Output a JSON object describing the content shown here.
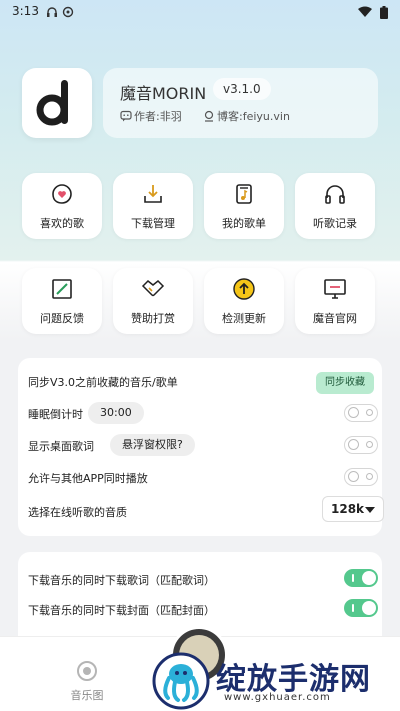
{
  "status_bar": {
    "time": "3:13"
  },
  "app": {
    "name": "魔音MORIN",
    "version": "v3.1.0",
    "author": "作者:非羽",
    "blog": "博客:feiyu.vin"
  },
  "tiles": [
    {
      "label": "喜欢的歌",
      "icon": "heart-icon"
    },
    {
      "label": "下载管理",
      "icon": "download-icon"
    },
    {
      "label": "我的歌单",
      "icon": "playlist-icon"
    },
    {
      "label": "听歌记录",
      "icon": "headphones-icon"
    },
    {
      "label": "问题反馈",
      "icon": "feedback-icon"
    },
    {
      "label": "赞助打赏",
      "icon": "handshake-icon"
    },
    {
      "label": "检测更新",
      "icon": "update-icon"
    },
    {
      "label": "魔音官网",
      "icon": "monitor-icon"
    }
  ],
  "settings": {
    "sync_label": "同步V3.0之前收藏的音乐/歌单",
    "sync_button": "同步收藏",
    "sleep_label": "睡眠倒计时",
    "sleep_value": "30:00",
    "lyrics_label": "显示桌面歌词",
    "float_permission": "悬浮窗权限?",
    "mix_label": "允许与其他APP同时播放",
    "quality_label": "选择在线听歌的音质",
    "quality_value": "128k",
    "toggles": {
      "sleep": false,
      "lyrics": false,
      "mix": false
    }
  },
  "download_settings": {
    "lyrics_label": "下载音乐的同时下载歌词（匹配歌词）",
    "cover_label": "下载音乐的同时下载封面（匹配封面）",
    "toggles": {
      "lyrics": true,
      "cover": true
    }
  },
  "bottom_nav": {
    "music_label": "音乐图"
  },
  "watermark": {
    "text": "绽放手游网",
    "url": "www.gxhuaer.com"
  },
  "colors": {
    "accent": "#54c88d",
    "sync_button_bg": "#b9ebd0",
    "watermark": "#1c2e6d"
  }
}
